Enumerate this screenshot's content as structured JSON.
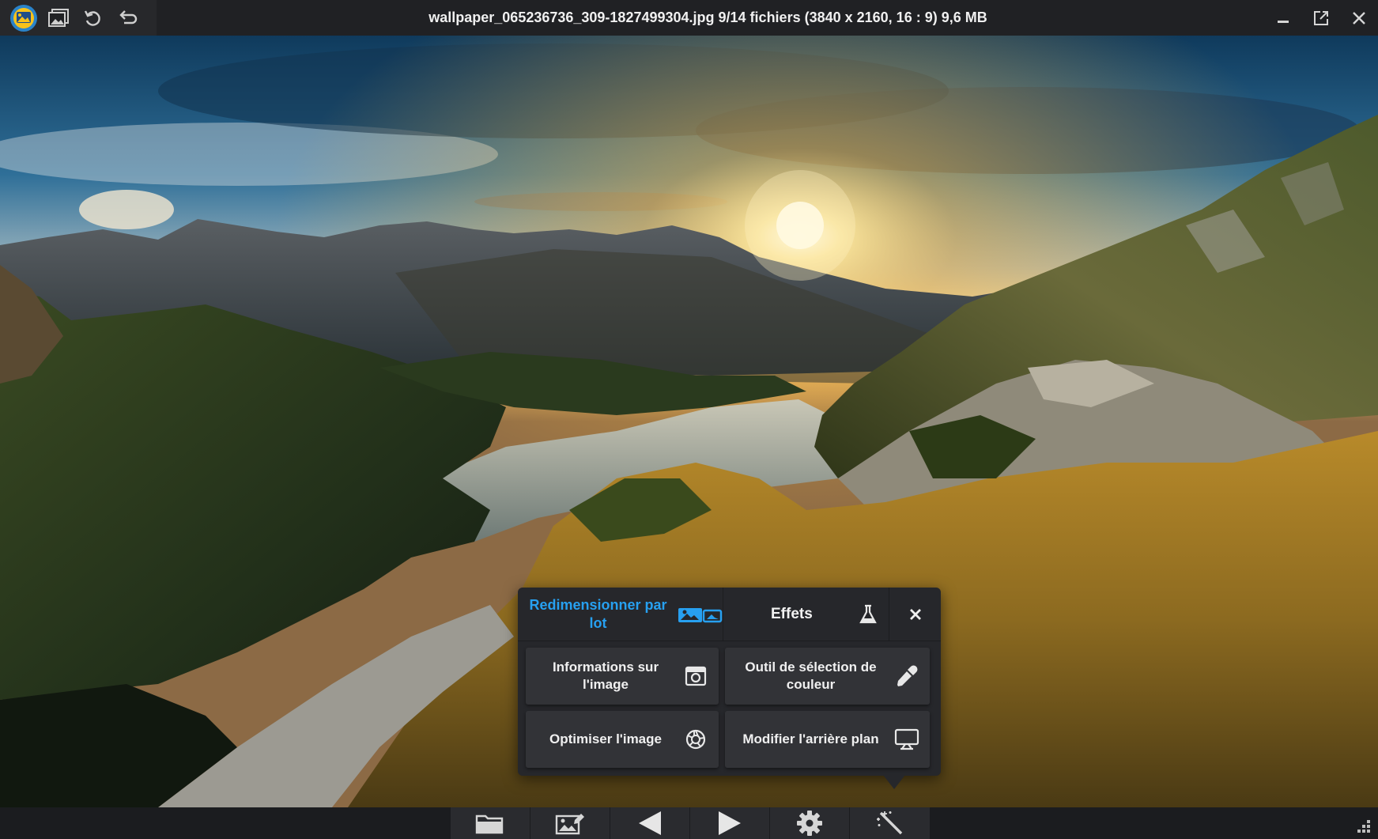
{
  "window": {
    "title": "wallpaper_065236736_309-1827499304.jpg 9/14 fichiers (3840 x 2160, 16 : 9) 9,6 MB",
    "icons": [
      "app-logo-icon",
      "gallery-icon",
      "rotate-icon",
      "undo-icon"
    ],
    "controls": [
      "minimize-icon",
      "fullscreen-icon",
      "close-icon"
    ]
  },
  "popup": {
    "resize_label": "Redimensionner par lot",
    "effects_label": "Effets",
    "tiles": [
      {
        "label": "Informations sur l'image",
        "icon": "camera-info-icon"
      },
      {
        "label": "Outil de sélection de couleur",
        "icon": "eyedropper-icon"
      },
      {
        "label": "Optimiser l'image",
        "icon": "aperture-icon"
      },
      {
        "label": "Modifier l'arrière plan",
        "icon": "monitor-icon"
      }
    ],
    "accent_color": "#27a0f0"
  },
  "bottombar": {
    "buttons": [
      "folder-icon",
      "image-edit-icon",
      "previous-icon",
      "next-icon",
      "settings-icon",
      "magic-wand-icon"
    ]
  }
}
